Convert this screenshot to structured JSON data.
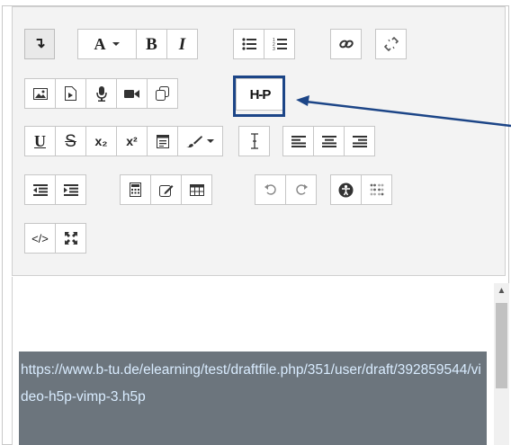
{
  "editor": {
    "toolbar": {
      "row1": {
        "collapse_label": "↴",
        "font_label": "A",
        "bold_label": "B",
        "italic_label": "I"
      },
      "row2": {
        "h5p_label": "H-P"
      },
      "row3": {
        "underline_label": "U",
        "strikethrough_label": "S",
        "subscript_label": "x₂",
        "superscript_label": "x²"
      },
      "row5": {
        "html_label": "</>"
      }
    },
    "content": {
      "selected_link": "https://www.b-tu.de/elearning/test/draftfile.php/351/user/draft/392859544/video-h5p-vimp-3.h5p"
    }
  },
  "colors": {
    "annotation_blue": "#1c4587",
    "selection_bg": "#6c757d",
    "link_text": "#d9ecff"
  }
}
